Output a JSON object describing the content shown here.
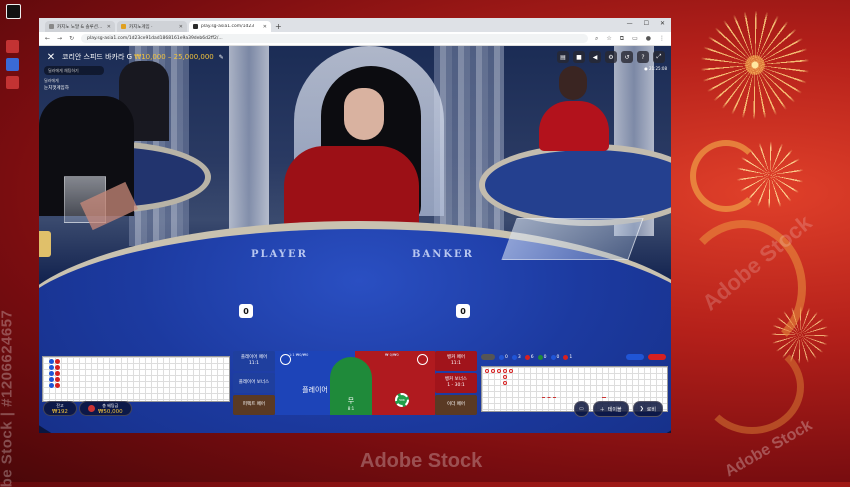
{
  "desktop": {
    "icons": [
      {
        "name": "desktop-icon-1",
        "label": "",
        "color": "#ffffff"
      },
      {
        "name": "desktop-icon-2",
        "label": "",
        "color": "#c33333"
      },
      {
        "name": "desktop-icon-3",
        "label": "",
        "color": "#3a6ad6"
      },
      {
        "name": "desktop-icon-4",
        "label": "",
        "color": "#c33333"
      }
    ],
    "watermark_side": "be Stock | #1206624657",
    "watermark_bottom": "Adobe Stock",
    "watermark_br": "Adobe Stock",
    "watermark_r": "Adobe Stock"
  },
  "browser": {
    "tabs": [
      {
        "label": "카지노 노말 & 솔루션 · 보증",
        "active": false
      },
      {
        "label": "카지노게임 ·",
        "active": false
      },
      {
        "label": "play.sg-asia1.com/1d23",
        "active": true
      }
    ],
    "new_tab": "+",
    "url": "play.sg-asia1.com/1d23ce91dad1868161e9a39deb6d2ff2/...",
    "window_controls": {
      "minimize": "—",
      "maximize": "☐",
      "close": "✕"
    }
  },
  "game": {
    "close": "✕",
    "title": "코리안 스피드 바카라 G",
    "limits": "₩10,000 – 25,000,000",
    "chat_placeholder": "딜러에게 채팅하기",
    "chat_lines": [
      {
        "text": "딜러에게",
        "bold": false
      },
      {
        "text": "눈치껏게임하",
        "bold": true
      }
    ],
    "clock": "● 21:25:08",
    "player_label": "PLAYER",
    "banker_label": "BANKER",
    "player_score": "0",
    "banker_score": "0",
    "bets": {
      "player_pair": "플레이어 페어",
      "player_pair_odds": "11:1",
      "player_bonus": "플레이어 보너스",
      "perfect_pair": "퍼펙트 페어",
      "player": "플레이어",
      "player_info": "1:1 ₩0/₩0",
      "tie": "무",
      "tie_odds": "8:1",
      "banker_info": "₩ 0/₩0",
      "banker_pair": "뱅커 페어",
      "banker_pair_odds": "11:1",
      "banker_bonus": "뱅커 보너스",
      "banker_bonus_odds": "1 - 30:1",
      "either_pair": "이더 페어",
      "chip": "50K"
    },
    "stats": [
      {
        "value": "0",
        "color": "#2055d6"
      },
      {
        "value": "3",
        "color": "#2055d6"
      },
      {
        "value": "6",
        "color": "#d62020"
      },
      {
        "value": "0",
        "color": "#1f8a3a"
      },
      {
        "value": "0",
        "color": "#2055d6"
      },
      {
        "value": "1",
        "color": "#d62020"
      }
    ],
    "balance_label": "잔고",
    "balance": "₩192",
    "total_bet_label": "총 베팅금",
    "total_bet": "₩50,000",
    "buttons": {
      "table": "테이블",
      "lobby": "로비"
    }
  }
}
